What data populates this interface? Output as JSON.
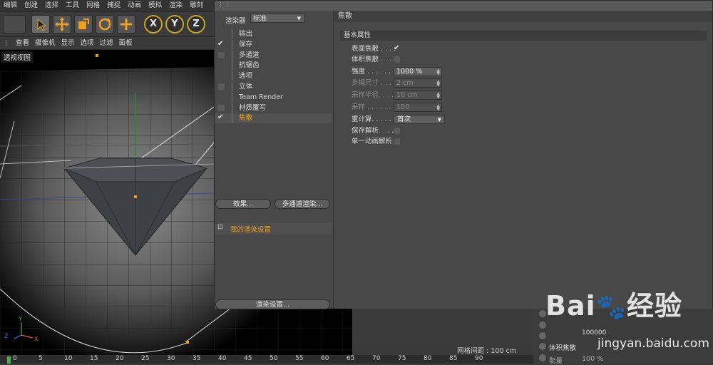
{
  "menu": [
    "编辑",
    "创建",
    "选择",
    "工具",
    "网格",
    "捕捉",
    "动画",
    "模拟",
    "渲染",
    "雕刻"
  ],
  "viewport": {
    "menu": [
      "查看",
      "摄像机",
      "显示",
      "选项",
      "过滤",
      "面板"
    ],
    "title": "透视视图",
    "grid_spacing": "网格间距 : 100 cm"
  },
  "toolbar": {
    "axis_x": "X",
    "axis_y": "Y",
    "axis_z": "Z"
  },
  "timeline": {
    "ticks": [
      "0",
      "5",
      "10",
      "15",
      "20",
      "25",
      "30",
      "35",
      "40",
      "45",
      "50",
      "55",
      "60",
      "65",
      "70",
      "75",
      "80",
      "85",
      "90"
    ]
  },
  "render_settings": {
    "renderer_label": "渲染器",
    "renderer_value": "标准",
    "items": [
      {
        "label": "输出",
        "check": "none"
      },
      {
        "label": "保存",
        "check": "checked"
      },
      {
        "label": "多通道",
        "check": "box"
      },
      {
        "label": "抗锯齿",
        "check": "none"
      },
      {
        "label": "选项",
        "check": "none"
      },
      {
        "label": "立体",
        "check": "box"
      },
      {
        "label": "Team Render",
        "check": "none"
      },
      {
        "label": "材质覆写",
        "check": "box"
      },
      {
        "label": "焦散",
        "check": "checked",
        "selected": true
      }
    ],
    "effects_button": "效果...",
    "multipass_button": "多通道渲染...",
    "preset_label": "我的渲染设置",
    "render_settings_button": "渲染设置...",
    "section_title": "焦散",
    "group_title": "基本属性",
    "props": {
      "surface_caustics": "表面焦散 . . . .",
      "volume_caustics": "体积焦散 . . . .",
      "intensity_label": "强度 . . . . . . .",
      "intensity_value": "1000 %",
      "step_size_label": "步幅尺寸 . . . .",
      "step_size_value": "2 cm",
      "sample_radius_label": "采样半径. . . .",
      "sample_radius_value": "10 cm",
      "samples_label": "采样 . . . . . . .",
      "samples_value": "100",
      "recompute_label": "重计算. . . . . .",
      "recompute_value": "首次",
      "save_solution": "保存解析. . . . .",
      "single_anim_solution": "单一动画解析"
    }
  },
  "attr_panel": {
    "row1_value": "100000",
    "row2_label": "体积焦散",
    "row3_label": "能量",
    "row3_value": "100 %"
  },
  "watermark": {
    "brand": "Bai",
    "brand_cn": "经验",
    "url": "jingyan.baidu.com"
  },
  "colors": {
    "accent": "#f0a020",
    "axis_ring": "#c9a227",
    "panel": "#4a4a4a"
  }
}
